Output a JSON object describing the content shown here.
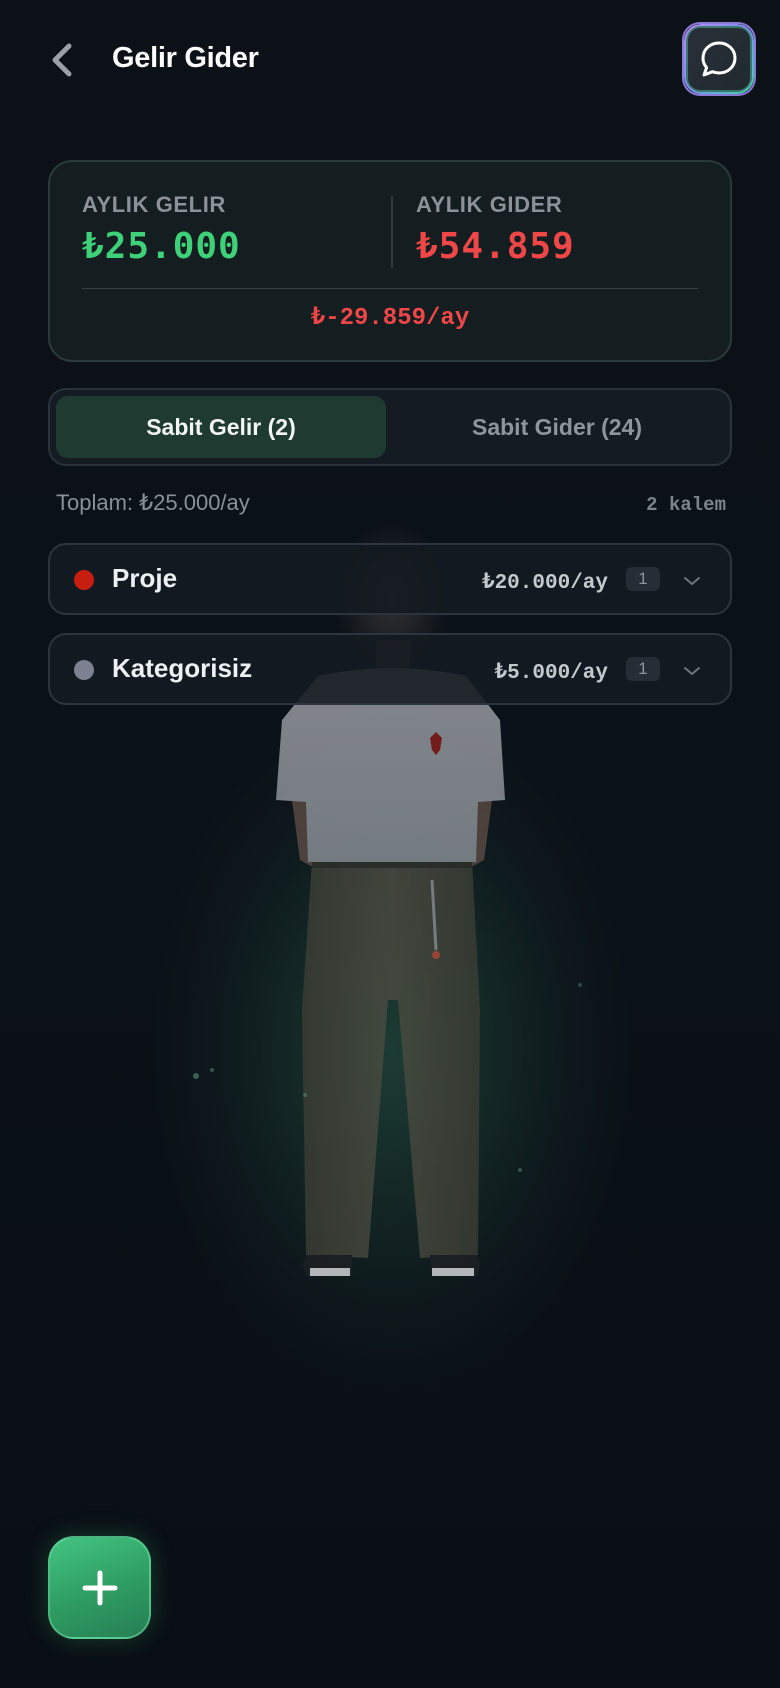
{
  "header": {
    "title": "Gelir Gider",
    "back_icon": "chevron-left-icon",
    "chat_icon": "chat-bubble-icon"
  },
  "summary": {
    "income_label": "AYLIK GELIR",
    "income_value": "₺25.000",
    "expense_label": "AYLIK GIDER",
    "expense_value": "₺54.859",
    "net_value": "₺-29.859/ay",
    "colors": {
      "income": "#3fd17a",
      "expense": "#ef4747"
    }
  },
  "tabs": [
    {
      "label": "Sabit Gelir (2)",
      "active": true
    },
    {
      "label": "Sabit Gider (24)",
      "active": false
    }
  ],
  "totals": {
    "total_text": "Toplam: ₺25.000/ay",
    "count_text": "2 kalem"
  },
  "categories": [
    {
      "name": "Proje",
      "amount": "₺20.000/ay",
      "count": "1",
      "dot_color": "#c81e12"
    },
    {
      "name": "Kategorisiz",
      "amount": "₺5.000/ay",
      "count": "1",
      "dot_color": "#7d8191"
    }
  ],
  "fab": {
    "icon": "plus-icon"
  }
}
